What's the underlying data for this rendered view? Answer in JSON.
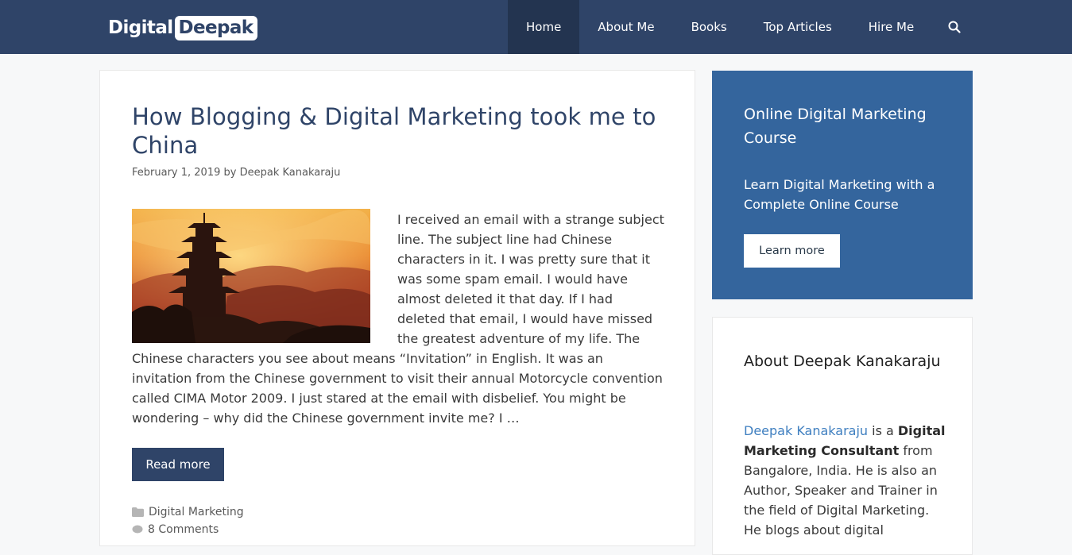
{
  "header": {
    "logo_part1": "Digital",
    "logo_part2": "Deepak",
    "nav": [
      {
        "label": "Home",
        "active": true
      },
      {
        "label": "About Me"
      },
      {
        "label": "Books"
      },
      {
        "label": "Top Articles"
      },
      {
        "label": "Hire Me"
      }
    ],
    "search_icon": "search-icon",
    "bg_color": "#2f4468"
  },
  "article": {
    "title": "How Blogging & Digital Marketing took me to China",
    "date": "February 1, 2019",
    "by": "by",
    "author": "Deepak Kanakaraju",
    "image": "pagoda-sunset-image",
    "excerpt": "I received an email with a strange subject line. The subject line had Chinese characters in it. I was pretty sure that it was some spam email. I would have almost deleted it that day. If I had deleted that email, I would have missed the greatest adventure of my life. The Chinese characters you see about means “Invitation” in English. It was an invitation from the Chinese government to visit their annual Motorcycle convention called CIMA Motor 2009. I just stared at the email with disbelief. You might be wondering – why did the Chinese government invite me? I …",
    "read_more": "Read more",
    "category": "Digital Marketing",
    "comments": "8 Comments"
  },
  "sidebar": {
    "promo": {
      "title": "Online Digital Marketing Course",
      "text": "Learn Digital Marketing with a Complete Online Course",
      "button": "Learn more",
      "bg_color": "#34659d"
    },
    "about": {
      "title": "About Deepak Kanakaraju",
      "link_name": "Deepak Kanakaraju",
      "is_a": " is a ",
      "bold1": "Digital Marketing Consultant",
      "rest1": " from Bangalore, India. He is also an Author, Speaker and Trainer in the field of Digital Marketing. He blogs about digital"
    }
  }
}
